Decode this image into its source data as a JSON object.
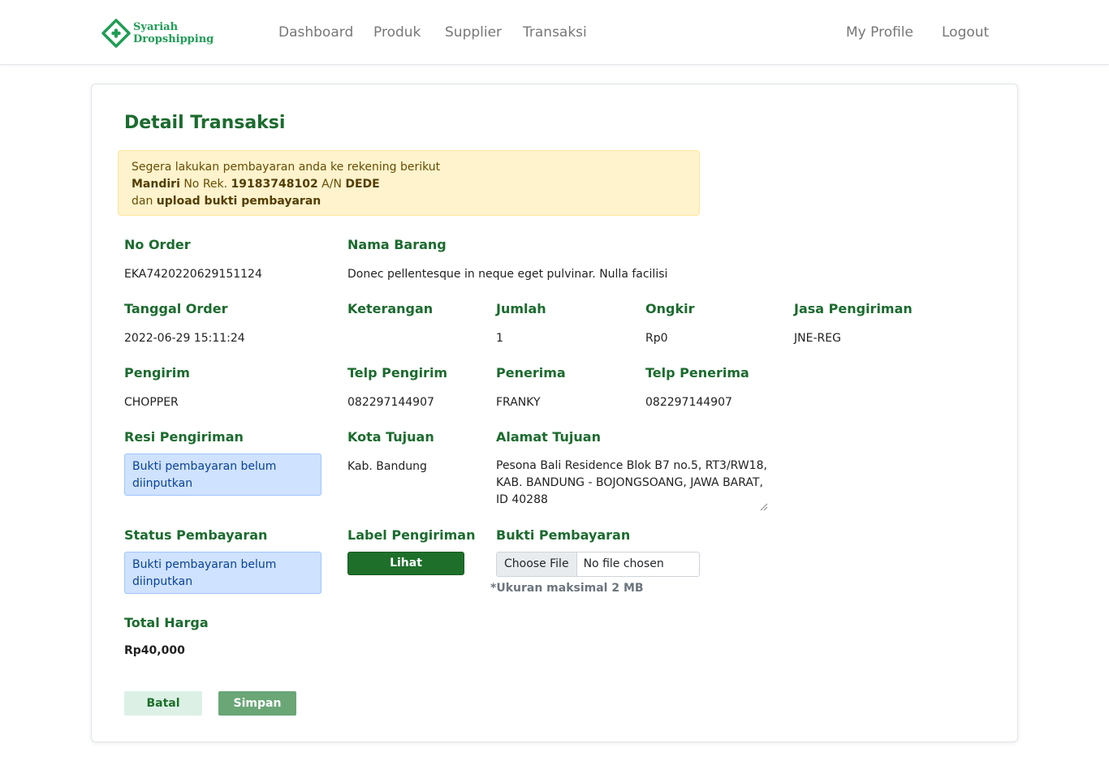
{
  "brand": {
    "line1": "Syariah",
    "line2": "Dropshipping",
    "color": "#1f9d55",
    "icon": "diamond-logo-icon"
  },
  "nav": {
    "dashboard": "Dashboard",
    "produk": "Produk",
    "supplier": "Supplier",
    "transaksi": "Transaksi",
    "profile": "My Profile",
    "logout": "Logout"
  },
  "page": {
    "title": "Detail Transaksi"
  },
  "alert": {
    "line1": "Segera lakukan pembayaran anda ke rekening berikut",
    "bank": "Mandiri",
    "no_rek_label": " No Rek. ",
    "no_rek": "19183748102",
    "an_label": " A/N ",
    "account_name": "DEDE",
    "line3_prefix": "dan ",
    "line3_bold": "upload bukti pembayaran"
  },
  "fields": {
    "no_order": {
      "label": "No Order",
      "value": "EKA7420220629151124"
    },
    "nama_barang": {
      "label": "Nama Barang",
      "value": "Donec pellentesque in neque eget pulvinar. Nulla facilisi"
    },
    "tanggal_order": {
      "label": "Tanggal Order",
      "value": "2022-06-29 15:11:24"
    },
    "keterangan": {
      "label": "Keterangan",
      "value": ""
    },
    "jumlah": {
      "label": "Jumlah",
      "value": "1"
    },
    "ongkir": {
      "label": "Ongkir",
      "value": "Rp0"
    },
    "jasa_pengiriman": {
      "label": "Jasa Pengiriman",
      "value": "JNE-REG"
    },
    "pengirim": {
      "label": "Pengirim",
      "value": "CHOPPER"
    },
    "telp_pengirim": {
      "label": "Telp Pengirim",
      "value": "082297144907"
    },
    "penerima": {
      "label": "Penerima",
      "value": "FRANKY"
    },
    "telp_penerima": {
      "label": "Telp Penerima",
      "value": "082297144907"
    },
    "resi_pengiriman": {
      "label": "Resi Pengiriman",
      "value": "Bukti pembayaran belum diinputkan"
    },
    "kota_tujuan": {
      "label": "Kota Tujuan",
      "value": "Kab. Bandung"
    },
    "alamat_tujuan": {
      "label": "Alamat Tujuan",
      "value": "Pesona Bali Residence Blok B7 no.5, RT3/RW18, KAB. BANDUNG - BOJONGSOANG, JAWA BARAT, ID 40288"
    },
    "status_pembayaran": {
      "label": "Status Pembayaran",
      "value": "Bukti pembayaran belum diinputkan"
    },
    "label_pengiriman": {
      "label": "Label Pengiriman",
      "button": "Lihat"
    },
    "bukti_pembayaran": {
      "label": "Bukti Pembayaran",
      "choose_file": "Choose File",
      "file_status": "No file chosen",
      "note": "*Ukuran maksimal 2 MB"
    },
    "total_harga": {
      "label": "Total Harga",
      "value": "Rp40,000"
    }
  },
  "actions": {
    "batal": "Batal",
    "simpan": "Simpan"
  },
  "colors": {
    "heading_green": "#1b6b2e",
    "alert_bg": "#fff3cd",
    "info_bg": "#cfe2ff",
    "primary_button": "#1d6f2a",
    "simpan_button": "#6aa676",
    "batal_button": "#dcf0e6"
  }
}
